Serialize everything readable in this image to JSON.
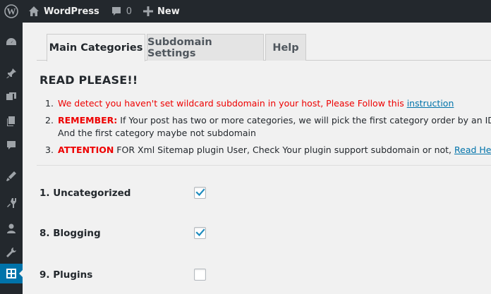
{
  "adminbar": {
    "site_name": "WordPress",
    "comments_count": "0",
    "new_label": "New"
  },
  "tabs": [
    {
      "label": "Main Categories",
      "active": true
    },
    {
      "label": "Subdomain Settings",
      "active": false
    },
    {
      "label": "Help",
      "active": false
    }
  ],
  "title": "READ PLEASE!!",
  "notes": [
    {
      "num": "1.",
      "text": "We detect you haven't set wildcard subdomain in your host, Please Follow this ",
      "link": "instruction"
    },
    {
      "num": "2.",
      "prefix": "REMEMBER:",
      "line1": " If Your post has two or more categories, we will pick the first category order by an ID.",
      "line2": "And the first category maybe not subdomain"
    },
    {
      "num": "3.",
      "prefix": "ATTENTION",
      "text": " FOR Xml Sitemap plugin User, Check Your plugin support subdomain or not, ",
      "link": "Read Here"
    }
  ],
  "categories": [
    {
      "label": "1. Uncategorized",
      "checked": true
    },
    {
      "label": "8. Blogging",
      "checked": true
    },
    {
      "label": "9. Plugins",
      "checked": false
    }
  ],
  "colors": {
    "admin_bg": "#23282d",
    "accent": "#0073aa",
    "warning_red": "#e00000"
  }
}
